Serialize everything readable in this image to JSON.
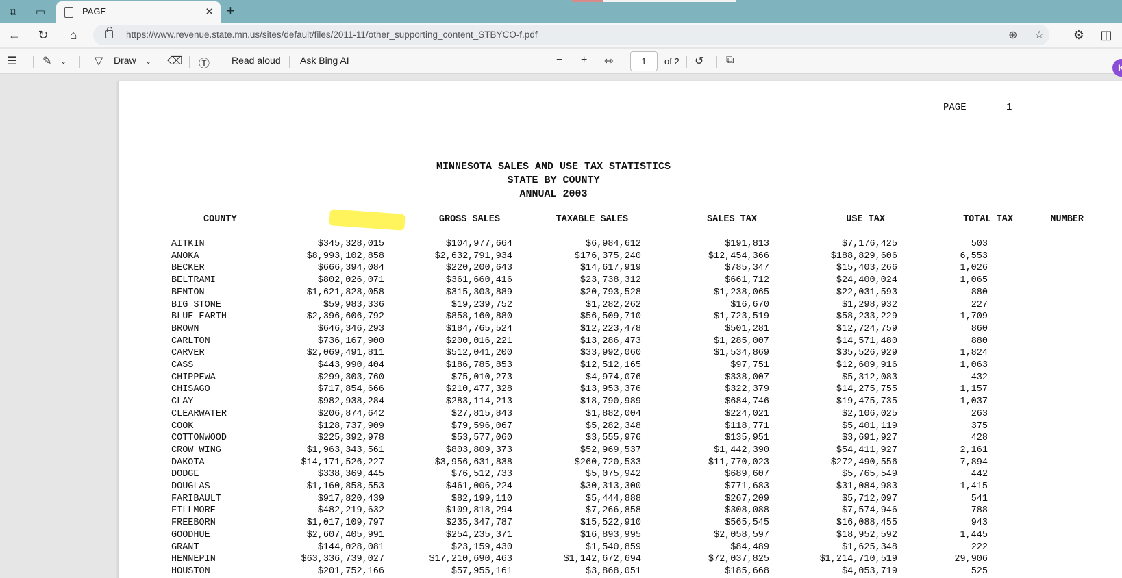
{
  "browser": {
    "tab": {
      "title": "PAGE"
    },
    "url": "https://www.revenue.state.mn.us/sites/default/files/2011-11/other_supporting_content_STBYCO-f.pdf"
  },
  "pdf_toolbar": {
    "draw_label": "Draw",
    "read_aloud_label": "Read aloud",
    "ask_bing_label": "Ask Bing AI",
    "current_page": "1",
    "page_count_label": "of 2"
  },
  "document": {
    "page_label": "PAGE",
    "page_number": "1",
    "title_lines": [
      "MINNESOTA SALES AND USE TAX STATISTICS",
      "STATE BY COUNTY",
      "ANNUAL 2003"
    ],
    "columns": {
      "county": "COUNTY",
      "gross": "GROSS SALES",
      "taxable": "TAXABLE SALES",
      "sales_tax": "SALES TAX",
      "use_tax": "USE TAX",
      "total_tax": "TOTAL TAX",
      "number": "NUMBER"
    },
    "rows": [
      [
        "AITKIN",
        "$345,328,015",
        "$104,977,664",
        "$6,984,612",
        "$191,813",
        "$7,176,425",
        "503"
      ],
      [
        "ANOKA",
        "$8,993,102,858",
        "$2,632,791,934",
        "$176,375,240",
        "$12,454,366",
        "$188,829,606",
        "6,553"
      ],
      [
        "BECKER",
        "$666,394,084",
        "$220,200,643",
        "$14,617,919",
        "$785,347",
        "$15,403,266",
        "1,026"
      ],
      [
        "BELTRAMI",
        "$802,026,071",
        "$361,660,416",
        "$23,738,312",
        "$661,712",
        "$24,400,024",
        "1,065"
      ],
      [
        "BENTON",
        "$1,621,828,058",
        "$315,303,889",
        "$20,793,528",
        "$1,238,065",
        "$22,031,593",
        "880"
      ],
      [
        "BIG STONE",
        "$59,983,336",
        "$19,239,752",
        "$1,282,262",
        "$16,670",
        "$1,298,932",
        "227"
      ],
      [
        "BLUE EARTH",
        "$2,396,606,792",
        "$858,160,880",
        "$56,509,710",
        "$1,723,519",
        "$58,233,229",
        "1,709"
      ],
      [
        "BROWN",
        "$646,346,293",
        "$184,765,524",
        "$12,223,478",
        "$501,281",
        "$12,724,759",
        "860"
      ],
      [
        "CARLTON",
        "$736,167,900",
        "$200,016,221",
        "$13,286,473",
        "$1,285,007",
        "$14,571,480",
        "880"
      ],
      [
        "CARVER",
        "$2,069,491,811",
        "$512,041,200",
        "$33,992,060",
        "$1,534,869",
        "$35,526,929",
        "1,824"
      ],
      [
        "CASS",
        "$443,990,404",
        "$186,785,853",
        "$12,512,165",
        "$97,751",
        "$12,609,916",
        "1,063"
      ],
      [
        "CHIPPEWA",
        "$299,303,760",
        "$75,010,273",
        "$4,974,076",
        "$338,007",
        "$5,312,083",
        "432"
      ],
      [
        "CHISAGO",
        "$717,854,666",
        "$210,477,328",
        "$13,953,376",
        "$322,379",
        "$14,275,755",
        "1,157"
      ],
      [
        "CLAY",
        "$982,938,284",
        "$283,114,213",
        "$18,790,989",
        "$684,746",
        "$19,475,735",
        "1,037"
      ],
      [
        "CLEARWATER",
        "$206,874,642",
        "$27,815,843",
        "$1,882,004",
        "$224,021",
        "$2,106,025",
        "263"
      ],
      [
        "COOK",
        "$128,737,909",
        "$79,596,067",
        "$5,282,348",
        "$118,771",
        "$5,401,119",
        "375"
      ],
      [
        "COTTONWOOD",
        "$225,392,978",
        "$53,577,060",
        "$3,555,976",
        "$135,951",
        "$3,691,927",
        "428"
      ],
      [
        "CROW WING",
        "$1,963,343,561",
        "$803,809,373",
        "$52,969,537",
        "$1,442,390",
        "$54,411,927",
        "2,161"
      ],
      [
        "DAKOTA",
        "$14,171,526,227",
        "$3,956,631,838",
        "$260,720,533",
        "$11,770,023",
        "$272,490,556",
        "7,894"
      ],
      [
        "DODGE",
        "$338,369,445",
        "$76,512,733",
        "$5,075,942",
        "$689,607",
        "$5,765,549",
        "442"
      ],
      [
        "DOUGLAS",
        "$1,160,858,553",
        "$461,006,224",
        "$30,313,300",
        "$771,683",
        "$31,084,983",
        "1,415"
      ],
      [
        "FARIBAULT",
        "$917,820,439",
        "$82,199,110",
        "$5,444,888",
        "$267,209",
        "$5,712,097",
        "541"
      ],
      [
        "FILLMORE",
        "$482,219,632",
        "$109,818,294",
        "$7,266,858",
        "$308,088",
        "$7,574,946",
        "788"
      ],
      [
        "FREEBORN",
        "$1,017,109,797",
        "$235,347,787",
        "$15,522,910",
        "$565,545",
        "$16,088,455",
        "943"
      ],
      [
        "GOODHUE",
        "$2,607,405,991",
        "$254,235,371",
        "$16,893,995",
        "$2,058,597",
        "$18,952,592",
        "1,445"
      ],
      [
        "GRANT",
        "$144,028,081",
        "$23,159,430",
        "$1,540,859",
        "$84,489",
        "$1,625,348",
        "222"
      ],
      [
        "HENNEPIN",
        "$63,336,739,027",
        "$17,210,690,463",
        "$1,142,672,694",
        "$72,037,825",
        "$1,214,710,519",
        "29,906"
      ],
      [
        "HOUSTON",
        "$201,752,166",
        "$57,955,161",
        "$3,868,051",
        "$185,668",
        "$4,053,719",
        "525"
      ]
    ]
  }
}
